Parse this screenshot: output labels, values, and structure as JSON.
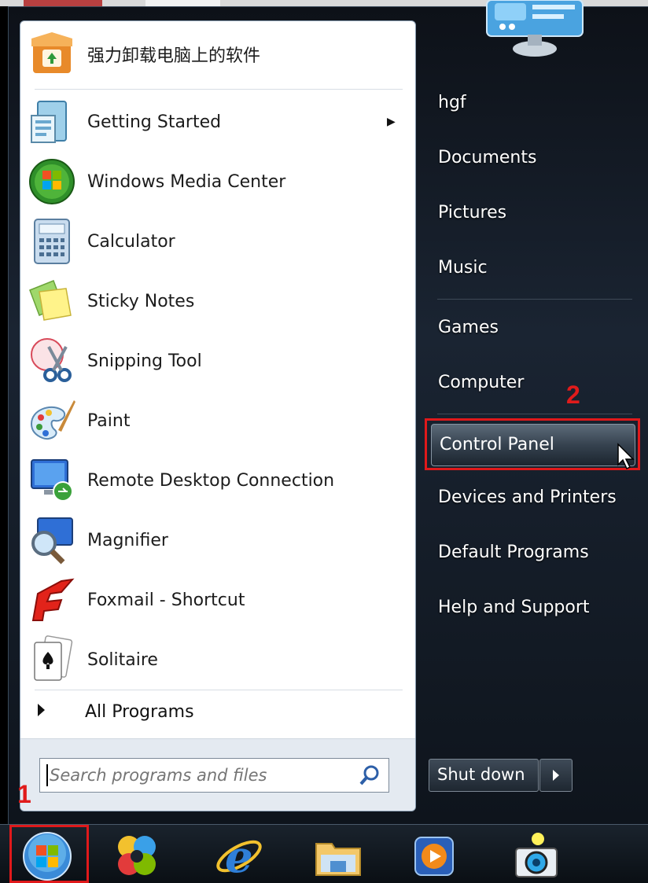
{
  "left_pane": {
    "pinned": {
      "label": "强力卸载电脑上的软件",
      "icon": "uninstall-box-icon"
    },
    "programs": [
      {
        "label": "Getting Started",
        "icon": "getting-started-icon",
        "has_submenu": true
      },
      {
        "label": "Windows Media Center",
        "icon": "media-center-icon",
        "has_submenu": false
      },
      {
        "label": "Calculator",
        "icon": "calculator-icon",
        "has_submenu": false
      },
      {
        "label": "Sticky Notes",
        "icon": "sticky-notes-icon",
        "has_submenu": false
      },
      {
        "label": "Snipping Tool",
        "icon": "snipping-tool-icon",
        "has_submenu": false
      },
      {
        "label": "Paint",
        "icon": "paint-palette-icon",
        "has_submenu": false
      },
      {
        "label": "Remote Desktop Connection",
        "icon": "remote-desktop-icon",
        "has_submenu": false
      },
      {
        "label": "Magnifier",
        "icon": "magnifier-icon",
        "has_submenu": false
      },
      {
        "label": "Foxmail - Shortcut",
        "icon": "foxmail-icon",
        "has_submenu": false
      },
      {
        "label": "Solitaire",
        "icon": "solitaire-icon",
        "has_submenu": false
      }
    ],
    "all_programs": "All Programs",
    "search": {
      "placeholder": "Search programs and files",
      "value": ""
    }
  },
  "right_pane": {
    "items": [
      {
        "label": "hgf"
      },
      {
        "label": "Documents"
      },
      {
        "label": "Pictures"
      },
      {
        "label": "Music"
      },
      {
        "label": "Games"
      },
      {
        "label": "Computer"
      },
      {
        "label": "Control Panel",
        "highlighted": true
      },
      {
        "label": "Devices and Printers"
      },
      {
        "label": "Default Programs"
      },
      {
        "label": "Help and Support"
      }
    ],
    "shutdown_label": "Shut down"
  },
  "annotations": {
    "step1": "1",
    "step2": "2",
    "color": "#e0191b"
  },
  "taskbar": {
    "icons": [
      "start-orb-icon",
      "app-swirl-icon",
      "internet-explorer-icon",
      "windows-explorer-icon",
      "media-player-icon",
      "camera-app-icon"
    ]
  }
}
